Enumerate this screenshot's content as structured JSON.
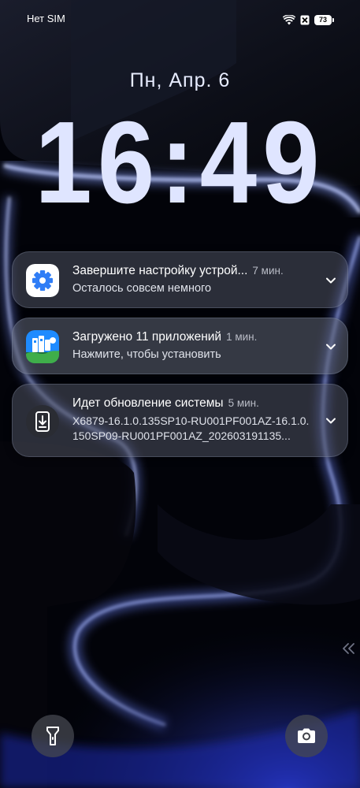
{
  "status_bar": {
    "carrier": "Нет SIM",
    "battery_level": "73",
    "icons": [
      "wifi-icon",
      "no-sim-icon",
      "battery-icon"
    ]
  },
  "lockscreen": {
    "date": "Пн, Апр. 6",
    "time": "16:49"
  },
  "notifications": [
    {
      "icon": "settings-gear-icon",
      "title": "Завершите настройку устрой...",
      "time": "7 мин.",
      "body": "Осталось совсем немного"
    },
    {
      "icon": "app-store-icon",
      "title": "Загружено 11 приложений",
      "time": "1 мин.",
      "body": "Нажмите, чтобы установить"
    },
    {
      "icon": "system-update-icon",
      "title": "Идет обновление системы",
      "time": "5 мин.",
      "body": "X6879-16.1.0.135SP10-RU001PF001AZ-16.1.0.150SP09-RU001PF001AZ_202603191135..."
    }
  ],
  "quick_actions": {
    "left": "flashlight-icon",
    "right": "camera-icon"
  },
  "colors": {
    "clock": "#dfe5ff",
    "background": "#020309",
    "notification_card": "#4e5260",
    "settings_icon_blue": "#2f7df6"
  }
}
